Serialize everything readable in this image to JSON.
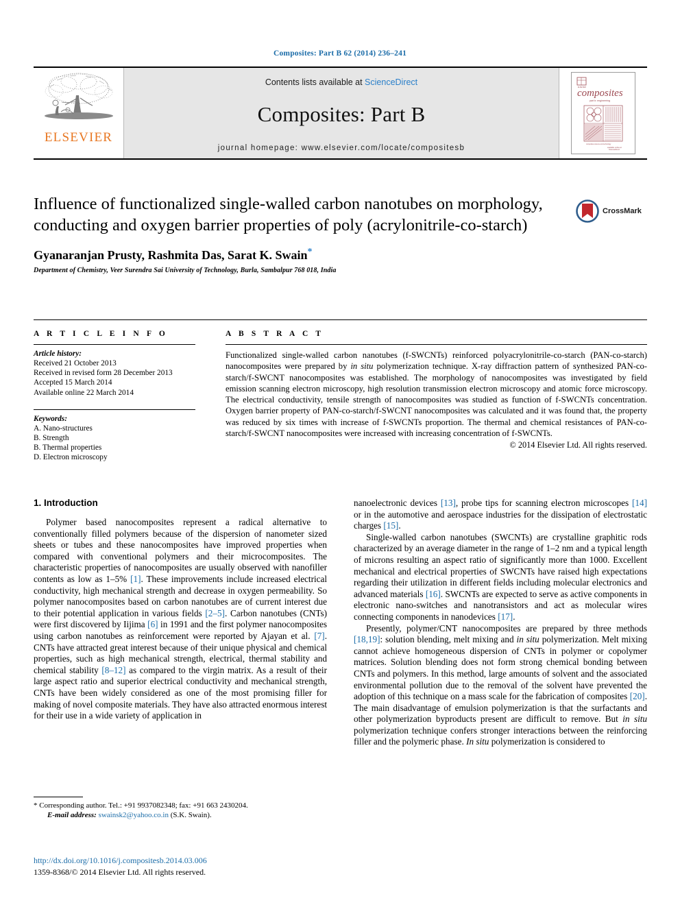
{
  "running_head": "Composites: Part B 62 (2014) 236–241",
  "masthead": {
    "publisher_name": "ELSEVIER",
    "contents_prefix": "Contents lists available at ",
    "contents_link": "ScienceDirect",
    "journal_title": "Composites: Part B",
    "homepage": "journal homepage: www.elsevier.com/locate/compositesb",
    "cover_word": "composites",
    "cover_subtitle": "part b: engineering"
  },
  "article": {
    "title": "Influence of functionalized single-walled carbon nanotubes on morphology, conducting and oxygen barrier properties of poly (acrylonitrile-co-starch)",
    "authors": "Gyanaranjan Prusty, Rashmita Das, Sarat K. Swain",
    "corresponding_marker": "*",
    "affiliation": "Department of Chemistry, Veer Surendra Sai University of Technology, Burla, Sambalpur 768 018, India",
    "crossmark_label": "CrossMark"
  },
  "article_info": {
    "heading": "A R T I C L E   I N F O",
    "history_label": "Article history:",
    "history": [
      "Received 21 October 2013",
      "Received in revised form 28 December 2013",
      "Accepted 15 March 2014",
      "Available online 22 March 2014"
    ],
    "keywords_label": "Keywords:",
    "keywords": [
      "A. Nano-structures",
      "B. Strength",
      "B. Thermal properties",
      "D. Electron microscopy"
    ]
  },
  "abstract": {
    "heading": "A B S T R A C T",
    "text": "Functionalized single-walled carbon nanotubes (f-SWCNTs) reinforced polyacrylonitrile-co-starch (PAN-co-starch) nanocomposites were prepared by in situ polymerization technique. X-ray diffraction pattern of synthesized PAN-co-starch/f-SWCNT nanocomposites was established. The morphology of nanocomposites was investigated by field emission scanning electron microscopy, high resolution transmission electron microscopy and atomic force microscopy. The electrical conductivity, tensile strength of nanocomposites was studied as function of f-SWCNTs concentration. Oxygen barrier property of PAN-co-starch/f-SWCNT nanocomposites was calculated and it was found that, the property was reduced by six times with increase of f-SWCNTs proportion. The thermal and chemical resistances of PAN-co-starch/f-SWCNT nanocomposites were increased with increasing concentration of f-SWCNTs.",
    "copyright": "© 2014 Elsevier Ltd. All rights reserved."
  },
  "section": {
    "number_title": "1. Introduction",
    "left_paragraphs": [
      "Polymer based nanocomposites represent a radical alternative to conventionally filled polymers because of the dispersion of nanometer sized sheets or tubes and these nanocomposites have improved properties when compared with conventional polymers and their microcomposites. The characteristic properties of nanocomposites are usually observed with nanofiller contents as low as 1–5% [1]. These improvements include increased electrical conductivity, high mechanical strength and decrease in oxygen permeability. So polymer nanocomposites based on carbon nanotubes are of current interest due to their potential application in various fields [2–5]. Carbon nanotubes (CNTs) were first discovered by Iijima [6] in 1991 and the first polymer nanocomposites using carbon nanotubes as reinforcement were reported by Ajayan et al. [7]. CNTs have attracted great interest because of their unique physical and chemical properties, such as high mechanical strength, electrical, thermal stability and chemical stability [8–12] as compared to the virgin matrix. As a result of their large aspect ratio and superior electrical conductivity and mechanical strength, CNTs have been widely considered as one of the most promising filler for making of novel composite materials. They have also attracted enormous interest for their use in a wide variety of application in"
    ],
    "right_paragraphs": [
      "nanoelectronic devices [13], probe tips for scanning electron microscopes [14] or in the automotive and aerospace industries for the dissipation of electrostatic charges [15].",
      "Single-walled carbon nanotubes (SWCNTs) are crystalline graphitic rods characterized by an average diameter in the range of 1–2 nm and a typical length of microns resulting an aspect ratio of significantly more than 1000. Excellent mechanical and electrical properties of SWCNTs have raised high expectations regarding their utilization in different fields including molecular electronics and advanced materials [16]. SWCNTs are expected to serve as active components in electronic nano-switches and nanotransistors and act as molecular wires connecting components in nanodevices [17].",
      "Presently, polymer/CNT nanocomposites are prepared by three methods [18,19]: solution blending, melt mixing and in situ polymerization. Melt mixing cannot achieve homogeneous dispersion of CNTs in polymer or copolymer matrices. Solution blending does not form strong chemical bonding between CNTs and polymers. In this method, large amounts of solvent and the associated environmental pollution due to the removal of the solvent have prevented the adoption of this technique on a mass scale for the fabrication of composites [20]. The main disadvantage of emulsion polymerization is that the surfactants and other polymerization byproducts present are difficult to remove. But in situ polymerization technique confers stronger interactions between the reinforcing filler and the polymeric phase. In situ polymerization is considered to"
    ]
  },
  "footnote": {
    "marker": "*",
    "corresponding": "Corresponding author. Tel.: +91 9937082348; fax: +91 663 2430204.",
    "email_label": "E-mail address:",
    "email": "swainsk2@yahoo.co.in",
    "email_owner": "(S.K. Swain)."
  },
  "footer": {
    "doi": "http://dx.doi.org/10.1016/j.compositesb.2014.03.006",
    "issn_line": "1359-8368/© 2014 Elsevier Ltd. All rights reserved."
  },
  "colors": {
    "link_blue": "#1b6ca8",
    "sciencedirect_blue": "#2a7fc9",
    "elsevier_orange": "#E87722",
    "band_grey": "#e6e6e6",
    "cover_maroon": "#9d4a52"
  }
}
